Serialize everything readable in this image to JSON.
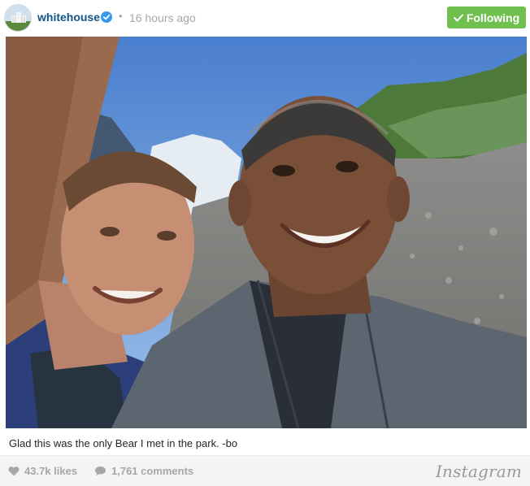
{
  "header": {
    "username": "whitehouse",
    "separator": "•",
    "time_ago": "16 hours ago",
    "follow_button_label": "Following",
    "verified_icon": "verified-badge-icon",
    "follow_check_icon": "checkmark-icon"
  },
  "post": {
    "caption": "Glad this was the only Bear I met in the park. -bo"
  },
  "footer": {
    "likes": "43.7k likes",
    "comments": "1,761 comments",
    "brand": "Instagram",
    "heart_icon": "heart-icon",
    "comment_icon": "comment-bubble-icon"
  },
  "colors": {
    "username": "#125688",
    "follow_button": "#70c050",
    "muted": "#a5a7aa",
    "verified": "#3897f0"
  }
}
